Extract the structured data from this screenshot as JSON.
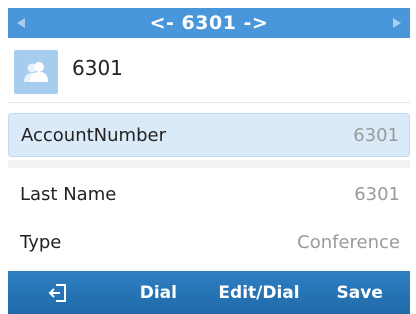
{
  "header": {
    "title": "<- 6301 ->",
    "left_icon": "caret-left-icon",
    "right_icon": "caret-right-icon"
  },
  "contact": {
    "name": "6301",
    "avatar_icon": "person-silhouette-icon"
  },
  "fields": [
    {
      "label": "AccountNumber",
      "value": "6301",
      "selected": true
    },
    {
      "label": "Last Name",
      "value": "6301",
      "selected": false
    },
    {
      "label": "Type",
      "value": "Conference",
      "selected": false
    }
  ],
  "softkeys": {
    "back_icon": "exit-icon",
    "dial": "Dial",
    "edit_dial": "Edit/Dial",
    "save": "Save"
  },
  "colors": {
    "header": "#4a96da",
    "softkey_bar": "#2476b8",
    "selected_row": "#dbeaf8",
    "avatar": "#a6cdee"
  }
}
